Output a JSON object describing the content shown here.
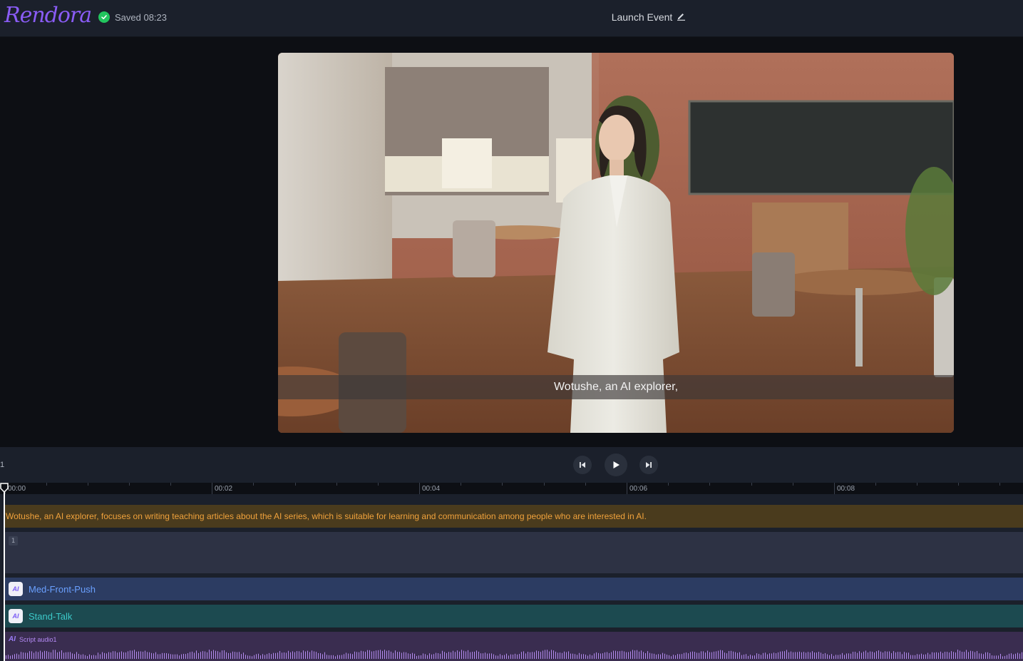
{
  "header": {
    "logo": "Rendora",
    "saved_status": "Saved 08:23",
    "project_title": "Launch Event"
  },
  "preview": {
    "subtitle": "Wotushe, an AI explorer,"
  },
  "playback": {
    "edge_mark": "1"
  },
  "ruler": {
    "labels": [
      "00:00",
      "00:02",
      "00:04",
      "00:06",
      "00:08"
    ]
  },
  "tracks": {
    "script_text": "Wotushe, an AI explorer, focuses on writing teaching articles about the AI series, which is suitable for learning and communication among people who are interested in AI.",
    "scene_index": "1",
    "camera_label": "Med-Front-Push",
    "pose_label": "Stand-Talk",
    "ai_badge": "AI",
    "audio_label": "Script audio1"
  },
  "colors": {
    "accent": "#8a5cf6",
    "saved_check": "#22c55e",
    "script_track": "#4a3b1d",
    "camera_track": "#2c3c62",
    "pose_track": "#1c4a50",
    "audio_track": "#3a2d50"
  }
}
